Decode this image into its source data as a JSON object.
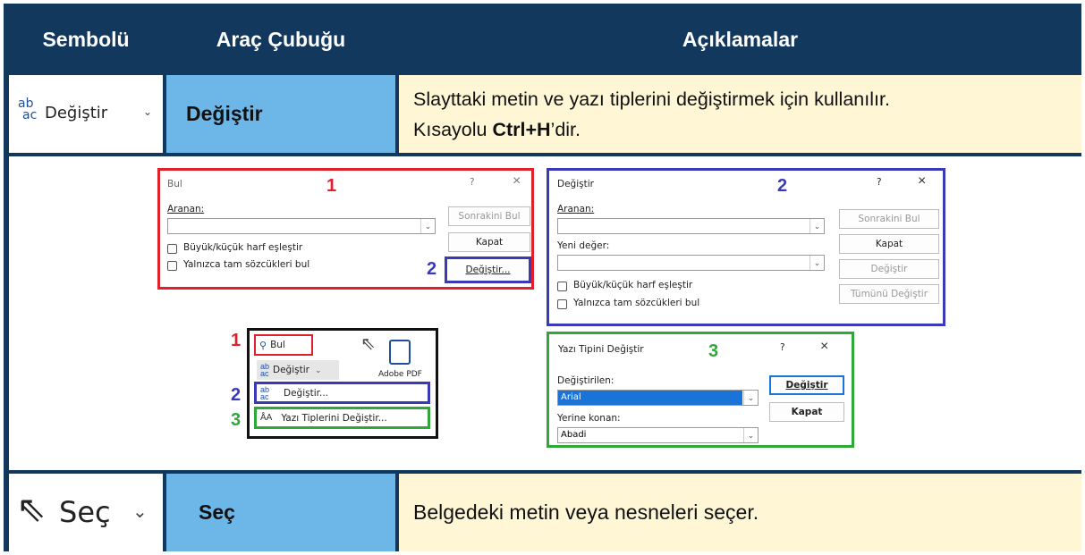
{
  "header": {
    "col1": "Sembolü",
    "col2": "Araç Çubuğu",
    "col3": "Açıklamalar"
  },
  "row1": {
    "symbol_label": "Değiştir",
    "toolbar": "Değiştir",
    "desc_line1": "Slayttaki metin ve yazı tiplerini değiştirmek için kullanılır.",
    "desc_line2_prefix": "Kısayolu ",
    "desc_line2_bold": "Ctrl+H",
    "desc_line2_suffix": "’dir."
  },
  "find_dialog": {
    "title": "Bul",
    "number": "1",
    "question": "?",
    "close": "×",
    "search_label": "Aranan:",
    "next_button": "Sonrakini Bul",
    "close_button": "Kapat",
    "replace_button": "Değiştir...",
    "match_case": "Büyük/küçük harf eşleştir",
    "whole_words": "Yalnızca tam sözcükleri bul",
    "replace_number": "2"
  },
  "replace_dialog": {
    "title": "Değiştir",
    "number": "2",
    "question": "?",
    "close": "×",
    "search_label": "Aranan:",
    "new_value_label": "Yeni değer:",
    "next_button": "Sonrakini Bul",
    "close_button": "Kapat",
    "replace_button": "Değiştir",
    "replace_all_button": "Tümünü Değiştir",
    "match_case": "Büyük/küçük harf eşleştir",
    "whole_words": "Yalnızca tam sözcükleri bul"
  },
  "menu": {
    "num1": "1",
    "num2": "2",
    "num3": "3",
    "find": "Bul",
    "replace_split": "Değiştir",
    "replace_item": "Değiştir...",
    "fonts_item": "Yazı Tiplerini Değiştir...",
    "adobe": "Adobe PDF"
  },
  "font_dialog": {
    "title": "Yazı Tipini Değiştir",
    "number": "3",
    "question": "?",
    "close": "×",
    "replaced_label": "Değiştirilen:",
    "replaced_value": "Arial",
    "with_label": "Yerine konan:",
    "with_value": "Abadi",
    "replace_button": "Değiştir",
    "close_button": "Kapat"
  },
  "row3": {
    "symbol_label": "Seç",
    "toolbar": "Seç",
    "desc": "Belgedeki metin veya nesneleri seçer."
  },
  "colors": {
    "header_bg": "#13385d",
    "toolbar_bg": "#6cb6e8",
    "desc_bg": "#fff6d6",
    "red": "#e0212b",
    "blue": "#3a3ab8",
    "green": "#2fa83a"
  }
}
